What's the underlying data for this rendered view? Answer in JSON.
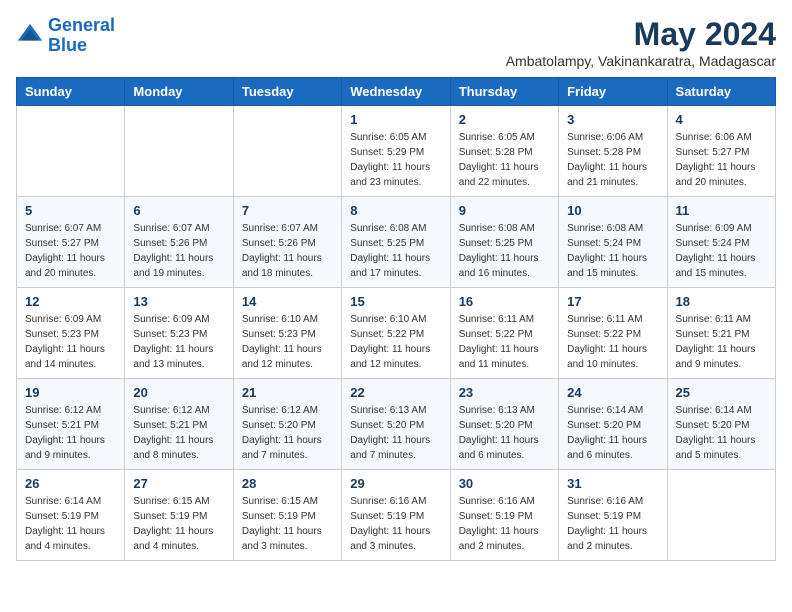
{
  "header": {
    "logo_line1": "General",
    "logo_line2": "Blue",
    "month_title": "May 2024",
    "subtitle": "Ambatolampy, Vakinankaratra, Madagascar"
  },
  "days_of_week": [
    "Sunday",
    "Monday",
    "Tuesday",
    "Wednesday",
    "Thursday",
    "Friday",
    "Saturday"
  ],
  "weeks": [
    [
      {
        "day": "",
        "sunrise": "",
        "sunset": "",
        "daylight": ""
      },
      {
        "day": "",
        "sunrise": "",
        "sunset": "",
        "daylight": ""
      },
      {
        "day": "",
        "sunrise": "",
        "sunset": "",
        "daylight": ""
      },
      {
        "day": "1",
        "sunrise": "Sunrise: 6:05 AM",
        "sunset": "Sunset: 5:29 PM",
        "daylight": "Daylight: 11 hours and 23 minutes."
      },
      {
        "day": "2",
        "sunrise": "Sunrise: 6:05 AM",
        "sunset": "Sunset: 5:28 PM",
        "daylight": "Daylight: 11 hours and 22 minutes."
      },
      {
        "day": "3",
        "sunrise": "Sunrise: 6:06 AM",
        "sunset": "Sunset: 5:28 PM",
        "daylight": "Daylight: 11 hours and 21 minutes."
      },
      {
        "day": "4",
        "sunrise": "Sunrise: 6:06 AM",
        "sunset": "Sunset: 5:27 PM",
        "daylight": "Daylight: 11 hours and 20 minutes."
      }
    ],
    [
      {
        "day": "5",
        "sunrise": "Sunrise: 6:07 AM",
        "sunset": "Sunset: 5:27 PM",
        "daylight": "Daylight: 11 hours and 20 minutes."
      },
      {
        "day": "6",
        "sunrise": "Sunrise: 6:07 AM",
        "sunset": "Sunset: 5:26 PM",
        "daylight": "Daylight: 11 hours and 19 minutes."
      },
      {
        "day": "7",
        "sunrise": "Sunrise: 6:07 AM",
        "sunset": "Sunset: 5:26 PM",
        "daylight": "Daylight: 11 hours and 18 minutes."
      },
      {
        "day": "8",
        "sunrise": "Sunrise: 6:08 AM",
        "sunset": "Sunset: 5:25 PM",
        "daylight": "Daylight: 11 hours and 17 minutes."
      },
      {
        "day": "9",
        "sunrise": "Sunrise: 6:08 AM",
        "sunset": "Sunset: 5:25 PM",
        "daylight": "Daylight: 11 hours and 16 minutes."
      },
      {
        "day": "10",
        "sunrise": "Sunrise: 6:08 AM",
        "sunset": "Sunset: 5:24 PM",
        "daylight": "Daylight: 11 hours and 15 minutes."
      },
      {
        "day": "11",
        "sunrise": "Sunrise: 6:09 AM",
        "sunset": "Sunset: 5:24 PM",
        "daylight": "Daylight: 11 hours and 15 minutes."
      }
    ],
    [
      {
        "day": "12",
        "sunrise": "Sunrise: 6:09 AM",
        "sunset": "Sunset: 5:23 PM",
        "daylight": "Daylight: 11 hours and 14 minutes."
      },
      {
        "day": "13",
        "sunrise": "Sunrise: 6:09 AM",
        "sunset": "Sunset: 5:23 PM",
        "daylight": "Daylight: 11 hours and 13 minutes."
      },
      {
        "day": "14",
        "sunrise": "Sunrise: 6:10 AM",
        "sunset": "Sunset: 5:23 PM",
        "daylight": "Daylight: 11 hours and 12 minutes."
      },
      {
        "day": "15",
        "sunrise": "Sunrise: 6:10 AM",
        "sunset": "Sunset: 5:22 PM",
        "daylight": "Daylight: 11 hours and 12 minutes."
      },
      {
        "day": "16",
        "sunrise": "Sunrise: 6:11 AM",
        "sunset": "Sunset: 5:22 PM",
        "daylight": "Daylight: 11 hours and 11 minutes."
      },
      {
        "day": "17",
        "sunrise": "Sunrise: 6:11 AM",
        "sunset": "Sunset: 5:22 PM",
        "daylight": "Daylight: 11 hours and 10 minutes."
      },
      {
        "day": "18",
        "sunrise": "Sunrise: 6:11 AM",
        "sunset": "Sunset: 5:21 PM",
        "daylight": "Daylight: 11 hours and 9 minutes."
      }
    ],
    [
      {
        "day": "19",
        "sunrise": "Sunrise: 6:12 AM",
        "sunset": "Sunset: 5:21 PM",
        "daylight": "Daylight: 11 hours and 9 minutes."
      },
      {
        "day": "20",
        "sunrise": "Sunrise: 6:12 AM",
        "sunset": "Sunset: 5:21 PM",
        "daylight": "Daylight: 11 hours and 8 minutes."
      },
      {
        "day": "21",
        "sunrise": "Sunrise: 6:12 AM",
        "sunset": "Sunset: 5:20 PM",
        "daylight": "Daylight: 11 hours and 7 minutes."
      },
      {
        "day": "22",
        "sunrise": "Sunrise: 6:13 AM",
        "sunset": "Sunset: 5:20 PM",
        "daylight": "Daylight: 11 hours and 7 minutes."
      },
      {
        "day": "23",
        "sunrise": "Sunrise: 6:13 AM",
        "sunset": "Sunset: 5:20 PM",
        "daylight": "Daylight: 11 hours and 6 minutes."
      },
      {
        "day": "24",
        "sunrise": "Sunrise: 6:14 AM",
        "sunset": "Sunset: 5:20 PM",
        "daylight": "Daylight: 11 hours and 6 minutes."
      },
      {
        "day": "25",
        "sunrise": "Sunrise: 6:14 AM",
        "sunset": "Sunset: 5:20 PM",
        "daylight": "Daylight: 11 hours and 5 minutes."
      }
    ],
    [
      {
        "day": "26",
        "sunrise": "Sunrise: 6:14 AM",
        "sunset": "Sunset: 5:19 PM",
        "daylight": "Daylight: 11 hours and 4 minutes."
      },
      {
        "day": "27",
        "sunrise": "Sunrise: 6:15 AM",
        "sunset": "Sunset: 5:19 PM",
        "daylight": "Daylight: 11 hours and 4 minutes."
      },
      {
        "day": "28",
        "sunrise": "Sunrise: 6:15 AM",
        "sunset": "Sunset: 5:19 PM",
        "daylight": "Daylight: 11 hours and 3 minutes."
      },
      {
        "day": "29",
        "sunrise": "Sunrise: 6:16 AM",
        "sunset": "Sunset: 5:19 PM",
        "daylight": "Daylight: 11 hours and 3 minutes."
      },
      {
        "day": "30",
        "sunrise": "Sunrise: 6:16 AM",
        "sunset": "Sunset: 5:19 PM",
        "daylight": "Daylight: 11 hours and 2 minutes."
      },
      {
        "day": "31",
        "sunrise": "Sunrise: 6:16 AM",
        "sunset": "Sunset: 5:19 PM",
        "daylight": "Daylight: 11 hours and 2 minutes."
      },
      {
        "day": "",
        "sunrise": "",
        "sunset": "",
        "daylight": ""
      }
    ]
  ]
}
